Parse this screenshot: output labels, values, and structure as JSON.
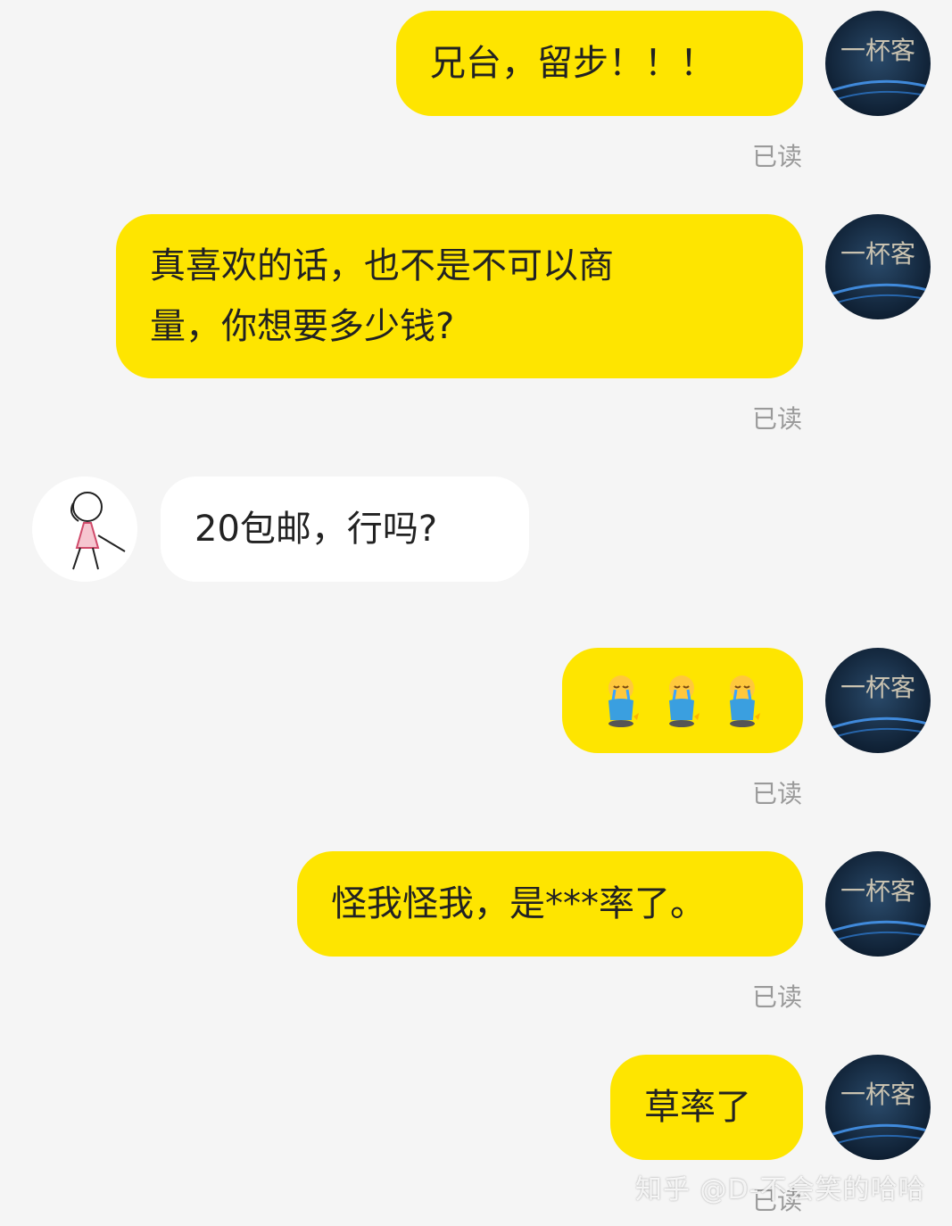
{
  "messages": [
    {
      "side": "right",
      "text": "兄台，留步！！！",
      "status": "已读"
    },
    {
      "side": "right",
      "text_line1": "真喜欢的话，也不是不可以商",
      "text_line2": "量，你想要多少钱?",
      "status": "已读"
    },
    {
      "side": "left",
      "text": "20包邮，行吗?"
    },
    {
      "side": "right",
      "emoji": [
        "crying-kneeling-emoji",
        "crying-kneeling-emoji",
        "crying-kneeling-emoji"
      ],
      "status": "已读"
    },
    {
      "side": "right",
      "text": "怪我怪我，是***率了。",
      "status": "已读"
    },
    {
      "side": "right",
      "text": "草率了",
      "status": "已读"
    }
  ],
  "self_avatar_text": "一杯客",
  "watermark": "知乎 @D-不会笑的哈哈",
  "colors": {
    "bubble_self": "#fee500",
    "bubble_other": "#ffffff",
    "background": "#f5f5f5"
  }
}
